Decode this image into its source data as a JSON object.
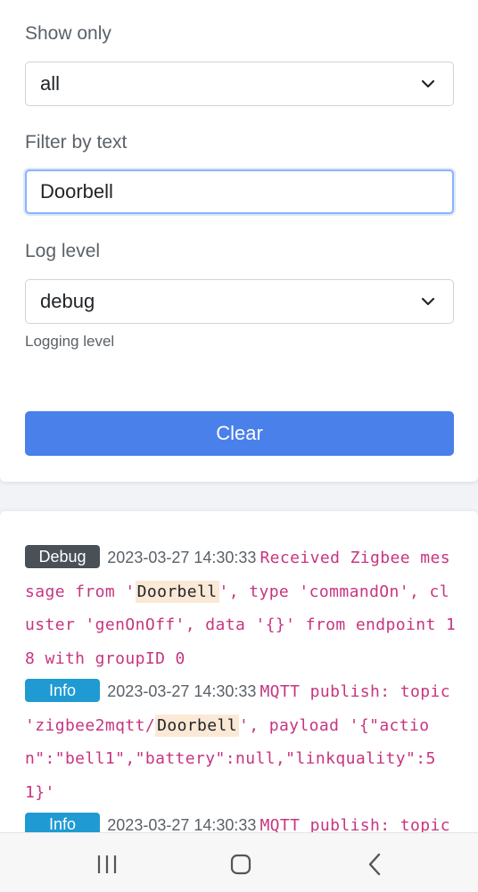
{
  "filters": {
    "show_only_label": "Show only",
    "show_only_value": "all",
    "filter_text_label": "Filter by text",
    "filter_text_value": "Doorbell",
    "log_level_label": "Log level",
    "log_level_value": "debug",
    "log_level_help": "Logging level",
    "clear_label": "Clear"
  },
  "logs": [
    {
      "level": "Debug",
      "timestamp": "2023-03-27 14:30:33",
      "pre": "Received Zigbee message from '",
      "highlight": "Doorbell",
      "post": "', type 'commandOn', cluster 'genOnOff', data '{}' from endpoint 18 with groupID 0"
    },
    {
      "level": "Info",
      "timestamp": "2023-03-27 14:30:33",
      "pre": "MQTT publish: topic 'zigbee2mqtt/",
      "highlight": "Doorbell",
      "post": "', payload '{\"action\":\"bell1\",\"battery\":null,\"linkquality\":51}'"
    },
    {
      "level": "Info",
      "timestamp": "2023-03-27 14:30:33",
      "pre": "MQTT publish: topic",
      "highlight": "",
      "post": ""
    }
  ],
  "colors": {
    "primary_button": "#4a80ea",
    "debug_badge": "#495057",
    "info_badge": "#1f9ad3",
    "message_text": "#c7357f",
    "highlight_bg": "#fbe9d6"
  },
  "navigation": {
    "recents_icon": "recent-apps-icon",
    "home_icon": "home-icon",
    "back_icon": "back-icon"
  }
}
